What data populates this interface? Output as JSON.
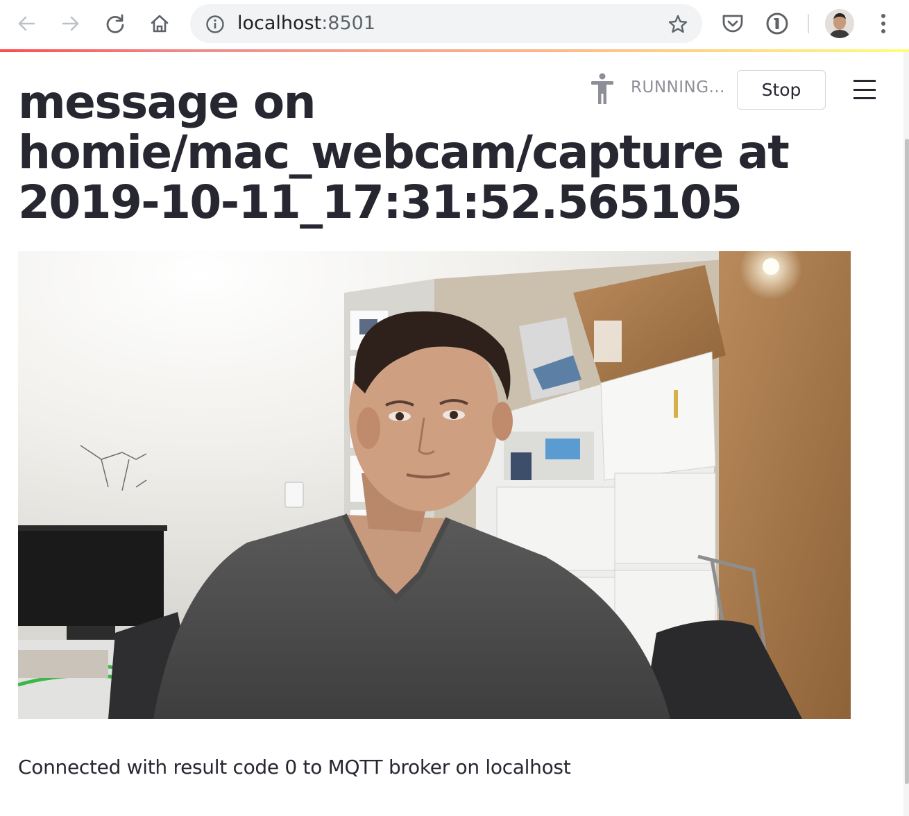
{
  "browser": {
    "url_host": "localhost",
    "url_port": ":8501",
    "icons": [
      "back-arrow-icon",
      "forward-arrow-icon",
      "reload-icon",
      "home-icon",
      "info-icon",
      "bookmark-star-icon",
      "pocket-icon",
      "password-manager-icon",
      "profile-avatar",
      "more-menu-icon"
    ]
  },
  "app": {
    "status_text": "RUNNING...",
    "status_icon": "running-man-icon",
    "stop_label": "Stop",
    "menu_icon": "hamburger-menu-icon",
    "accent_gradient": [
      "#ff4b4b",
      "#fdb78a",
      "#fffd80"
    ]
  },
  "main": {
    "title": "message on homie/mac_webcam/capture at 2019-10-11_17:31:52.565105",
    "image_alt": "Webcam capture of a man in a grey t-shirt in an office",
    "status_message": "Connected with result code 0 to MQTT broker on localhost"
  },
  "colors": {
    "text": "#262730",
    "muted": "#8e8e98",
    "omnibox_bg": "#f1f3f4"
  }
}
